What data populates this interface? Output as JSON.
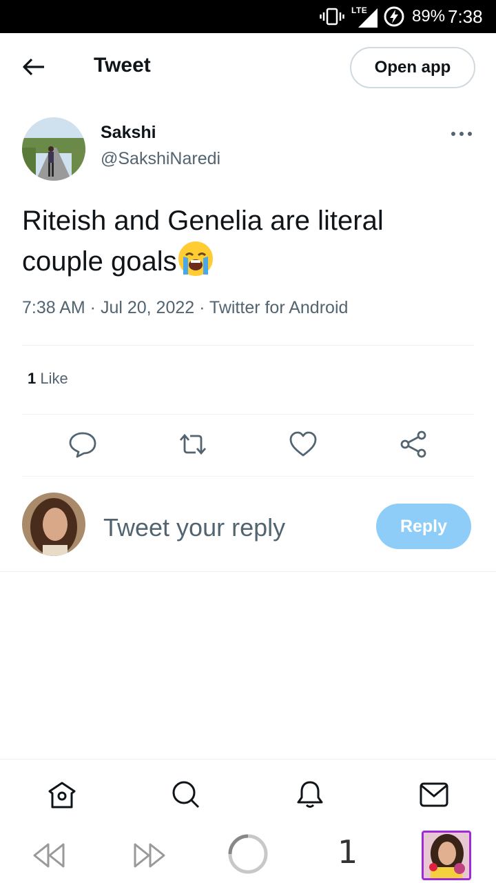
{
  "status_bar": {
    "network": "LTE",
    "battery": "89%",
    "time": "7:38"
  },
  "header": {
    "title": "Tweet",
    "open_app_label": "Open app"
  },
  "tweet": {
    "author_name": "Sakshi",
    "author_handle": "@SakshiNaredi",
    "text_line1": "Riteish and Genelia are literal",
    "text_line2": "couple goals",
    "emoji": "loudly-crying-face",
    "meta": "7:38 AM · Jul 20, 2022 · Twitter for Android",
    "likes_count": "1",
    "likes_label": "Like"
  },
  "reply": {
    "placeholder": "Tweet your reply",
    "button_label": "Reply"
  },
  "browser": {
    "tab_count": "1"
  },
  "colors": {
    "reply_button": "#8ecdf8",
    "text_primary": "#0f1419",
    "text_secondary": "#536471",
    "divider": "#eff3f4",
    "tab_border": "#9c2bd6"
  }
}
